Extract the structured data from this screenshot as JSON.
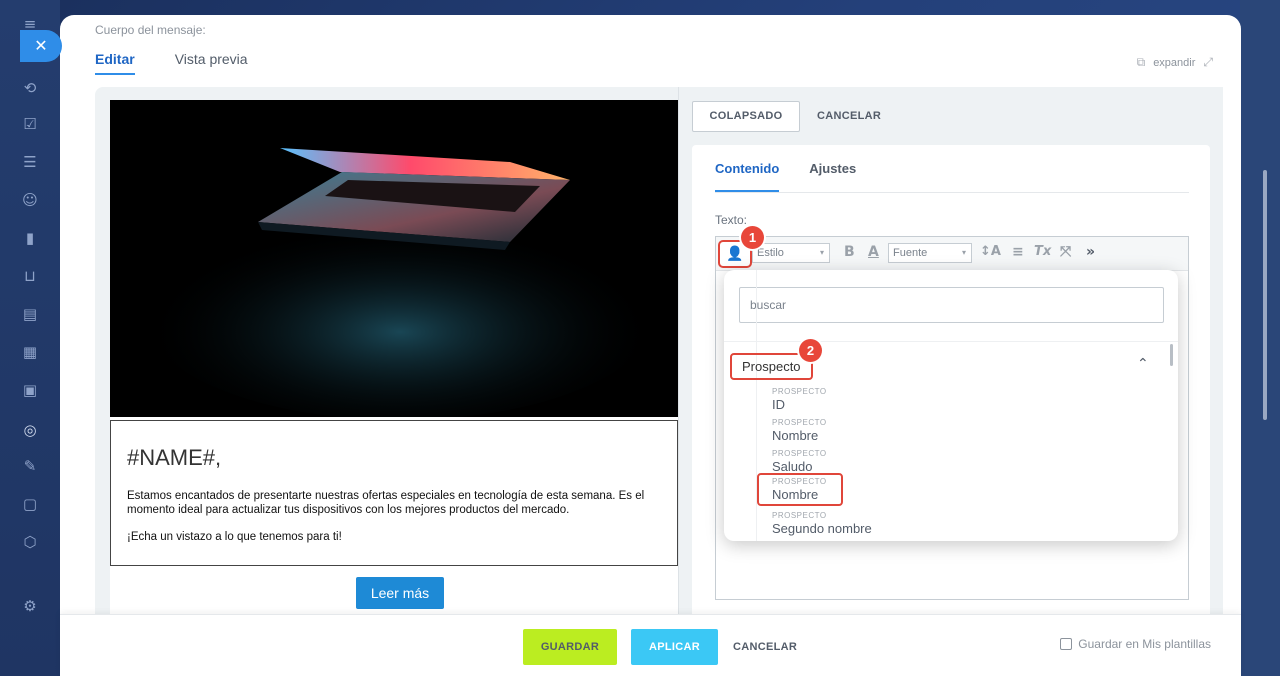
{
  "sidebar": {
    "close_glyph": "✕",
    "icons": [
      {
        "name": "menu-icon",
        "glyph": "≡"
      },
      {
        "name": "crm-icon",
        "glyph": "⟲"
      },
      {
        "name": "tasks-icon",
        "glyph": "☑"
      },
      {
        "name": "filter-icon",
        "glyph": "☰"
      },
      {
        "name": "robot-icon",
        "glyph": "☺"
      },
      {
        "name": "analytics-icon",
        "glyph": "▮"
      },
      {
        "name": "cart-icon",
        "glyph": "⊔"
      },
      {
        "name": "contact-card-icon",
        "glyph": "▤"
      },
      {
        "name": "calendar-icon",
        "glyph": "▦"
      },
      {
        "name": "store-icon",
        "glyph": "▣"
      },
      {
        "name": "marketing-icon",
        "glyph": "◎"
      },
      {
        "name": "pen-icon",
        "glyph": "✎"
      },
      {
        "name": "document-icon",
        "glyph": "▢"
      },
      {
        "name": "box-icon",
        "glyph": "⬡"
      },
      {
        "name": "settings-icon",
        "glyph": "⚙"
      }
    ]
  },
  "header": {
    "message_body_label": "Cuerpo del mensaje:",
    "tabs": [
      {
        "label": "Editar",
        "active": true
      },
      {
        "label": "Vista previa",
        "active": false
      }
    ],
    "expand_label": "expandir",
    "expand_icon": "⧉",
    "expand_arrows": "⤢"
  },
  "email": {
    "title": "#NAME#,",
    "body_1": "Estamos encantados de presentarte nuestras ofertas especiales en tecnología de esta semana. Es el momento ideal para actualizar tus dispositivos con los mejores productos del mercado.",
    "body_2": "¡Echa un vistazo a lo que tenemos para ti!",
    "button_label": "Leer más"
  },
  "settings": {
    "collapse_label": "COLAPSADO",
    "cancel_label": "CANCELAR",
    "tabs": [
      {
        "label": "Contenido",
        "active": true
      },
      {
        "label": "Ajustes",
        "active": false
      }
    ],
    "text_label": "Texto:",
    "toolbar": {
      "personalize_glyph": "👤",
      "style_placeholder": "Estilo",
      "bold": "B",
      "text_color": "A",
      "font_placeholder": "Fuente",
      "font_size": "↕A",
      "align": "≡",
      "clear_format": "Tx",
      "maximize": "⤧",
      "more": "»",
      "caret": "▾"
    },
    "popup": {
      "search_placeholder": "buscar",
      "group_label": "Prospecto",
      "group_chevron": "⌃",
      "items": [
        {
          "category": "PROSPECTO",
          "name": "ID"
        },
        {
          "category": "PROSPECTO",
          "name": "Nombre"
        },
        {
          "category": "PROSPECTO",
          "name": "Saludo"
        },
        {
          "category": "PROSPECTO",
          "name": "Nombre"
        },
        {
          "category": "PROSPECTO",
          "name": "Segundo nombre"
        }
      ]
    }
  },
  "badges": [
    "1",
    "2"
  ],
  "footer": {
    "save_label": "GUARDAR",
    "apply_label": "APLICAR",
    "cancel_label": "CANCELAR",
    "save_template_label": "Guardar en Mis plantillas"
  },
  "colors": {
    "accent": "#2f8de8",
    "highlight": "#e0463a",
    "save_green": "#bbed21",
    "apply_cyan": "#3bc8f5"
  }
}
